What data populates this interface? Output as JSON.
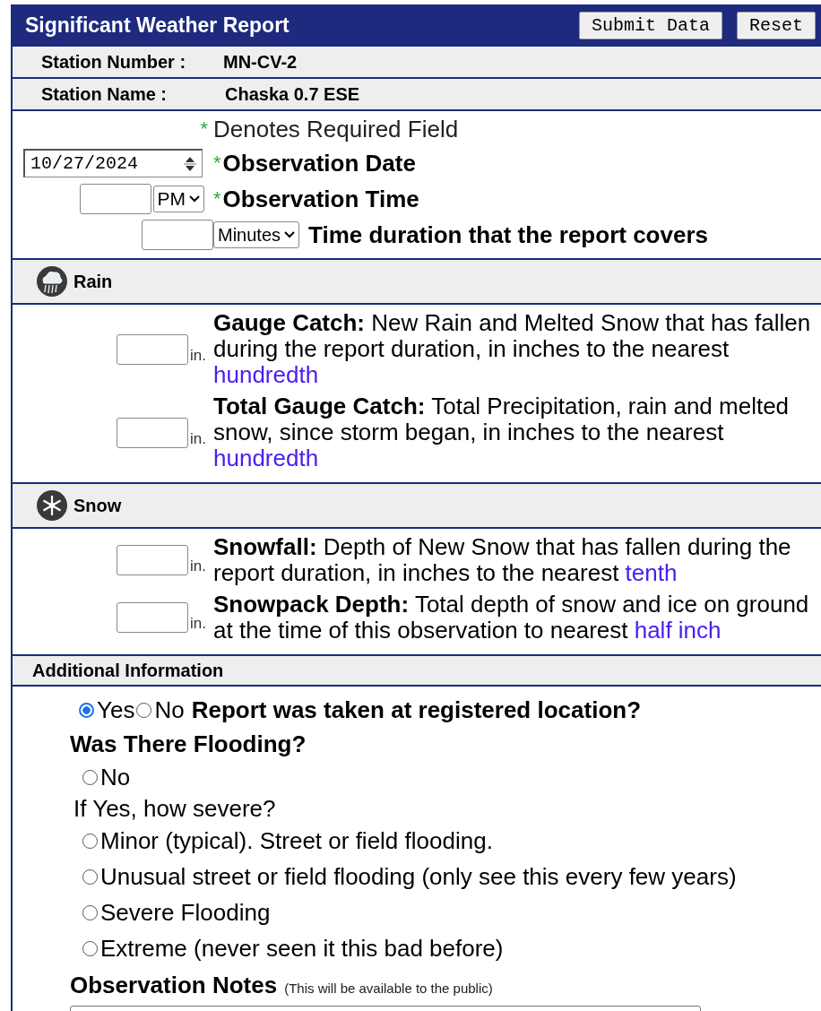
{
  "header": {
    "title": "Significant Weather Report",
    "buttons": [
      "Submit Data",
      "Reset"
    ]
  },
  "station": [
    {
      "label": "Station Number :",
      "value": "MN-CV-2"
    },
    {
      "label": "Station Name :",
      "value": "Chaska 0.7 ESE"
    }
  ],
  "required_note": {
    "mark": "*",
    "text": "Denotes Required Field"
  },
  "fields": [
    {
      "kind": "date",
      "value": "10/27/2024",
      "required_mark": "*",
      "label": "Observation Date"
    },
    {
      "kind": "time",
      "select": "PM",
      "required_mark": "*",
      "label": "Observation Time"
    },
    {
      "kind": "duration",
      "select": "Minutes",
      "label": "Time duration that the report covers"
    }
  ],
  "sections": [
    {
      "title": "Rain",
      "kind": "rain",
      "measurements": [
        {
          "unit": "in.",
          "title": "Gauge Catch:",
          "description": "New Rain and Melted Snow that has fallen during the report duration, in inches to the nearest",
          "link": "hundredth"
        },
        {
          "unit": "in.",
          "title": "Total Gauge Catch:",
          "description": "Total Precipitation, rain and melted snow, since storm began, in inches to the nearest",
          "link": "hundredth"
        }
      ]
    },
    {
      "title": "Snow",
      "kind": "snow",
      "measurements": [
        {
          "unit": "in.",
          "title": "Snowfall:",
          "description": "Depth of New Snow that has fallen during the report duration, in inches to the nearest",
          "link": "tenth"
        },
        {
          "unit": "in.",
          "title": "Snowpack Depth:",
          "description": "Total depth of snow and ice on ground at the time of this observation to nearest",
          "link": "half inch"
        }
      ]
    }
  ],
  "additional": {
    "title": "Additional Information",
    "location": {
      "options": [
        {
          "label": "Yes",
          "selected": true
        },
        {
          "label": "No",
          "selected": false
        }
      ],
      "question": "Report was taken at registered location?"
    },
    "flooding": {
      "title": "Was There Flooding?",
      "no_option": {
        "label": "No",
        "selected": false
      },
      "severity_prompt": "If Yes, how severe?",
      "options": [
        {
          "label": "Minor (typical). Street or field flooding.",
          "selected": false
        },
        {
          "label": "Unusual street or field flooding (only see this every few years)",
          "selected": false
        },
        {
          "label": "Severe Flooding",
          "selected": false
        },
        {
          "label": "Extreme (never seen it this bad before)",
          "selected": false
        }
      ]
    },
    "notes": {
      "title": "Observation Notes",
      "hint": "(This will be available to the public)"
    }
  }
}
